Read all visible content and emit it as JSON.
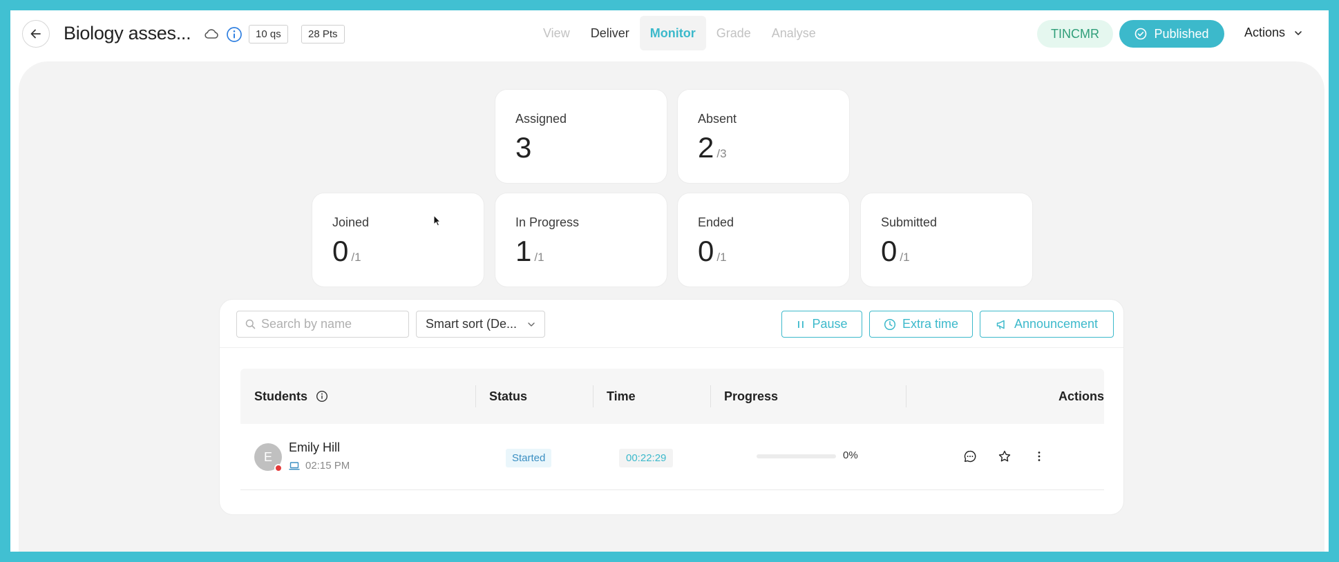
{
  "header": {
    "title": "Biology asses...",
    "chips": {
      "questions": "10 qs",
      "points": "28 Pts"
    },
    "nav_tabs": [
      {
        "label": "View",
        "state": "disabled"
      },
      {
        "label": "Deliver",
        "state": "normal"
      },
      {
        "label": "Monitor",
        "state": "active"
      },
      {
        "label": "Grade",
        "state": "disabled"
      },
      {
        "label": "Analyse",
        "state": "disabled"
      }
    ],
    "code": "TINCMR",
    "published_label": "Published",
    "actions_label": "Actions"
  },
  "stats": {
    "assigned": {
      "label": "Assigned",
      "value": "3",
      "total": ""
    },
    "absent": {
      "label": "Absent",
      "value": "2",
      "total": "/3"
    },
    "joined": {
      "label": "Joined",
      "value": "0",
      "total": "/1"
    },
    "in_progress": {
      "label": "In Progress",
      "value": "1",
      "total": "/1"
    },
    "ended": {
      "label": "Ended",
      "value": "0",
      "total": "/1"
    },
    "submitted": {
      "label": "Submitted",
      "value": "0",
      "total": "/1"
    }
  },
  "toolbar": {
    "search_placeholder": "Search by name",
    "sort_label": "Smart sort (De...",
    "pause_label": "Pause",
    "extra_time_label": "Extra time",
    "announcement_label": "Announcement"
  },
  "table": {
    "headers": {
      "students": "Students",
      "status": "Status",
      "time": "Time",
      "progress": "Progress",
      "actions": "Actions"
    },
    "rows": [
      {
        "initial": "E",
        "name": "Emily Hill",
        "joined_time": "02:15 PM",
        "status": "Started",
        "time": "00:22:29",
        "progress": 0,
        "progress_label": "0%"
      }
    ]
  },
  "colors": {
    "accent": "#3cb9cb",
    "frame": "#41c0d2",
    "code_bg": "#e5f7ef",
    "code_fg": "#2f9e79",
    "offline_dot": "#e53a3a"
  }
}
